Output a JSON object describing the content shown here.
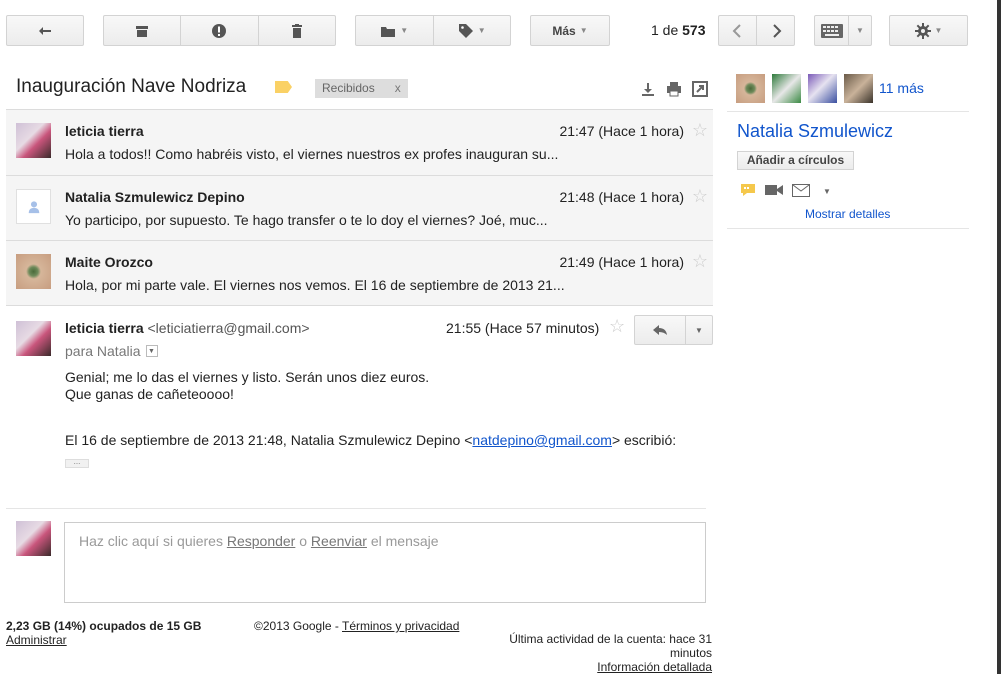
{
  "toolbar": {
    "more_label": "Más",
    "pager_prefix": "1 de",
    "pager_total": "573"
  },
  "thread": {
    "subject": "Inauguración Nave Nodriza",
    "label_chip": "Recibidos",
    "label_chip_close": "x"
  },
  "messages": [
    {
      "from": "leticia tierra",
      "time": "21:47 (Hace 1 hora)",
      "snippet": "Hola a todos!! Como habréis visto, el viernes nuestros ex profes inauguran su..."
    },
    {
      "from": "Natalia Szmulewicz Depino",
      "time": "21:48 (Hace 1 hora)",
      "snippet": "Yo participo, por supuesto. Te hago transfer o te lo doy el viernes? Joé, muc..."
    },
    {
      "from": "Maite Orozco",
      "time": "21:49 (Hace 1 hora)",
      "snippet": "Hola, por mi parte vale. El viernes nos vemos. El 16 de septiembre de 2013 21..."
    }
  ],
  "open_message": {
    "from": "leticia tierra",
    "email": "<leticiatierra@gmail.com>",
    "time": "21:55 (Hace 57 minutos)",
    "to": "para Natalia",
    "body_line1": "Genial; me lo das el viernes y listo. Serán unos diez euros.",
    "body_line2": "Que ganas de cañeteoooo!",
    "quote_prefix": "El 16 de septiembre de 2013 21:48, Natalia Szmulewicz Depino <",
    "quote_link": "natdepino@gmail.com",
    "quote_suffix": "> escribió:"
  },
  "reply": {
    "prefix": "Haz clic aquí si quieres ",
    "respond": "Responder",
    "middle": " o ",
    "forward": "Reenviar",
    "suffix": " el mensaje"
  },
  "footer": {
    "storage": "2,23 GB (14%) ocupados de 15 GB",
    "admin": "Administrar",
    "copyright": "©2013 Google - ",
    "terms": "Términos y privacidad",
    "activity": "Última actividad de la cuenta: hace 31 minutos",
    "details": "Información detallada"
  },
  "people": {
    "more": "11 más",
    "name": "Natalia Szmulewicz",
    "add_circles": "Añadir a círculos",
    "show_details": "Mostrar detalles"
  },
  "colors": {
    "link": "#1155cc",
    "label_yellow": "#fad165"
  }
}
